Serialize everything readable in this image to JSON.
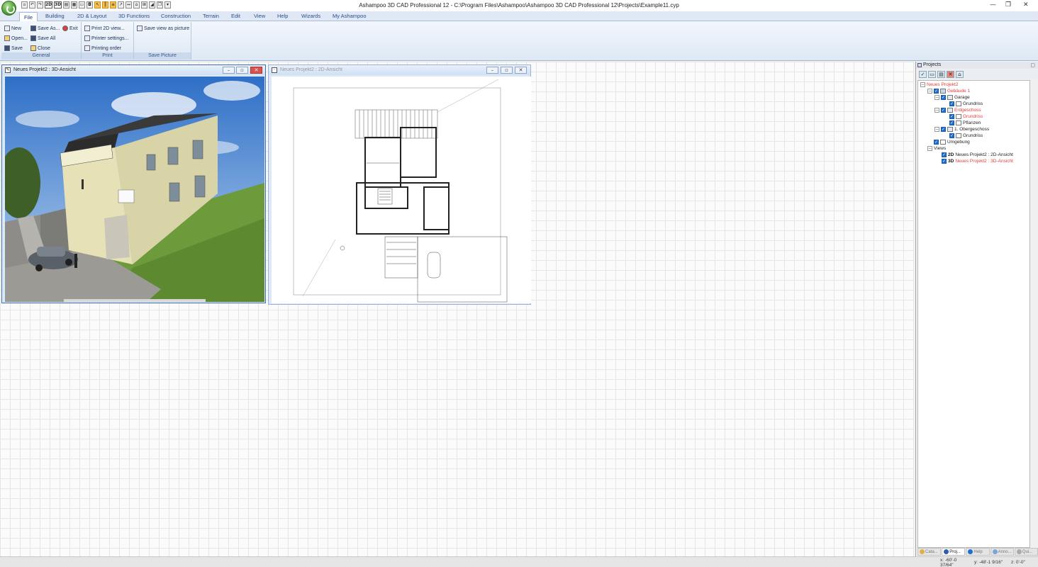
{
  "window": {
    "title": "Ashampoo 3D CAD Professional 12 - C:\\Program Files\\Ashampoo\\Ashampoo 3D CAD Professional 12\\Projects\\Example11.cyp",
    "minimize": "—",
    "restore": "❐",
    "close": "✕"
  },
  "quick_access": [
    "2D",
    "3D"
  ],
  "tabs": [
    "File",
    "Building",
    "2D & Layout",
    "3D Functions",
    "Construction",
    "Terrain",
    "Edit",
    "View",
    "Help",
    "Wizards",
    "My Ashampoo"
  ],
  "ribbon": {
    "general": {
      "label": "General",
      "new": "New",
      "open": "Open...",
      "save": "Save",
      "save_as": "Save As...",
      "save_all": "Save All",
      "close": "Close",
      "exit": "Exit"
    },
    "print": {
      "label": "Print",
      "print_2d": "Print 2D view...",
      "printer_settings": "Printer settings...",
      "printing_order": "Printing order"
    },
    "save_picture": {
      "label": "Save Picture",
      "save_view": "Save view as picture"
    }
  },
  "views": {
    "view3d_title": "Neues Projekt2 : 3D-Ansicht",
    "view2d_title": "Neues Projekt2 : 2D-Ansicht"
  },
  "projects_panel": {
    "title": "Projects",
    "tree": {
      "project": "Neues Projekt2",
      "building": "Gebäude 1",
      "garage": "Garage",
      "garage_grundriss": "Grundriss",
      "erdgeschoss": "Erdgeschoss",
      "eg_grundriss": "Grundriss",
      "eg_pflanzen": "Pflanzen",
      "obergeschoss": "1. Obergeschoss",
      "og_grundriss": "Grundriss",
      "umgebung": "Umgebung",
      "views": "Views",
      "view_2d_badge": "2D",
      "view_2d": "Neues Projekt2 : 2D-Ansicht",
      "view_3d_badge": "3D",
      "view_3d": "Neues Projekt2 : 3D-Ansicht"
    },
    "bottom_tabs": [
      "Cata...",
      "Proj...",
      "Help",
      "Anno...",
      "Qui..."
    ]
  },
  "statusbar": {
    "x": "x: -60'-0 37/64\"",
    "y": "y: -48'-1 9/16\"",
    "z": "z: 0'-0\""
  },
  "colors": {
    "tab_text": "#2b4f8a",
    "ribbon_bg": "#dde8f4",
    "tree_highlight": "#e0403a",
    "checkbox": "#1f6fd1"
  }
}
